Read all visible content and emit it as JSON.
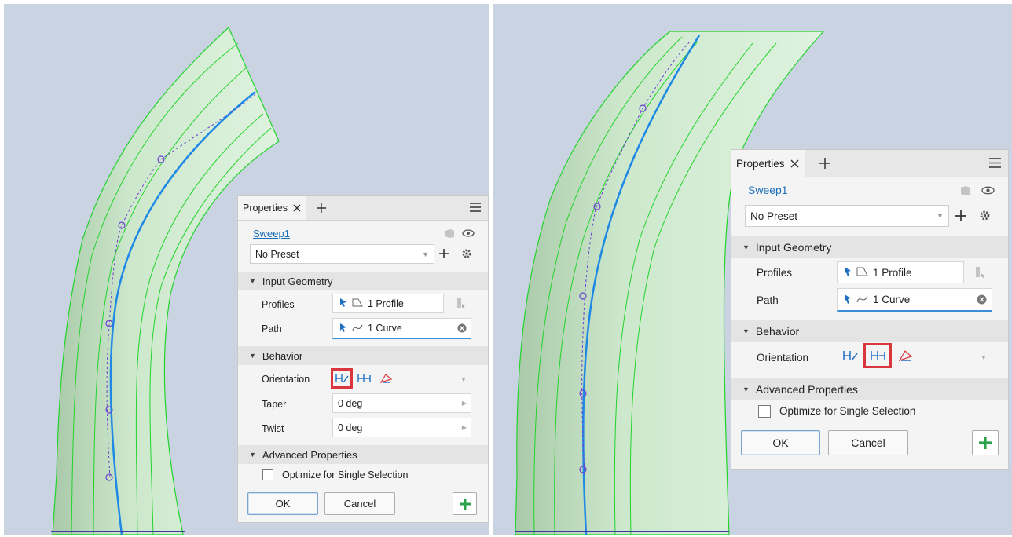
{
  "panels": [
    {
      "tab_label": "Properties",
      "feature_name": "Sweep1",
      "preset": "No Preset",
      "sections": {
        "input_geometry": "Input Geometry",
        "behavior": "Behavior",
        "advanced": "Advanced Properties"
      },
      "labels": {
        "profiles": "Profiles",
        "path": "Path",
        "orientation": "Orientation",
        "taper": "Taper",
        "twist": "Twist"
      },
      "profiles_value": "1 Profile",
      "path_value": "1 Curve",
      "taper_value": "0 deg",
      "twist_value": "0 deg",
      "optimize_label": "Optimize for Single Selection",
      "ok": "OK",
      "cancel": "Cancel",
      "selected_orientation": "path"
    },
    {
      "tab_label": "Properties",
      "feature_name": "Sweep1",
      "preset": "No Preset",
      "sections": {
        "input_geometry": "Input Geometry",
        "behavior": "Behavior",
        "advanced": "Advanced Properties"
      },
      "labels": {
        "profiles": "Profiles",
        "path": "Path",
        "orientation": "Orientation"
      },
      "profiles_value": "1 Profile",
      "path_value": "1 Curve",
      "optimize_label": "Optimize for Single Selection",
      "ok": "OK",
      "cancel": "Cancel",
      "selected_orientation": "parallel"
    }
  ],
  "colors": {
    "viewport_bg": "#c9d3e2",
    "edge_green": "#22d32a",
    "path_blue": "#1e88e5",
    "dash_purple": "#6a3fd0",
    "highlight_red": "#d9363e",
    "accent_blue": "#1c6fb8"
  }
}
